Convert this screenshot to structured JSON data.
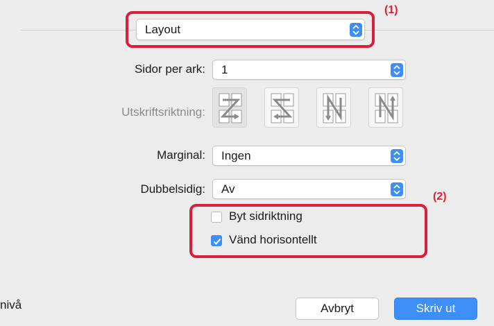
{
  "layout_popup": {
    "value": "Layout",
    "callout": "(1)"
  },
  "sidor_per_ark": {
    "label": "Sidor per ark:",
    "value": "1"
  },
  "utskriftsriktning": {
    "label": "Utskriftsriktning:",
    "options": [
      "z-orientation-icon",
      "s-reverse-orientation-icon",
      "n-reverse-orientation-icon",
      "n-orientation-icon"
    ]
  },
  "marginal": {
    "label": "Marginal:",
    "value": "Ingen"
  },
  "dubbelsidig": {
    "label": "Dubbelsidig:",
    "value": "Av"
  },
  "options_group": {
    "callout": "(2)",
    "byt_sidriktning": {
      "label": "Byt sidriktning",
      "checked": false
    },
    "vand_horisontellt": {
      "label": "Vänd horisontellt",
      "checked": true
    }
  },
  "footer": {
    "left_text": "nivå",
    "cancel_label": "Avbryt",
    "print_label": "Skriv ut"
  },
  "colors": {
    "accent": "#3d8ef7",
    "callout": "#d8203a",
    "panel": "#ececec"
  }
}
